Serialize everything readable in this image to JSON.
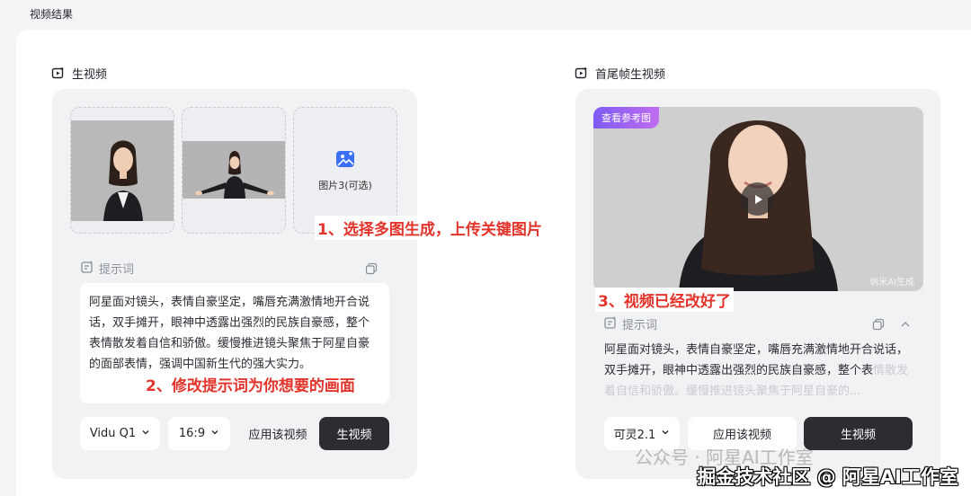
{
  "page": {
    "title": "视频结果"
  },
  "left_panel": {
    "header": "生视频",
    "image_slot_3_label": "图片3(可选)",
    "annotation_upload": "1、选择多图生成，上传关键图片",
    "prompt_label": "提示词",
    "prompt_text": "阿星面对镜头，表情自豪坚定，嘴唇充满激情地开合说话，双手摊开，眼神中透露出强烈的民族自豪感，整个表情散发着自信和骄傲。缓慢推进镜头聚焦于阿星自豪的面部表情，强调中国新生代的强大实力。",
    "annotation_prompt": "2、修改提示词为你想要的画面",
    "model_select": "Vidu Q1",
    "ratio_select": "16:9",
    "apply_button": "应用该视频",
    "generate_button": "生视频"
  },
  "right_panel": {
    "header": "首尾帧生视频",
    "ref_tag": "查看参考图",
    "video_watermark": "纳米AI生成",
    "annotation_done": "3、视频已经改好了",
    "prompt_label": "提示词",
    "prompt_text": "阿星面对镜头，表情自豪坚定，嘴唇充满激情地开合说话，双手摊开，眼神中透露出强烈的民族自豪感，整个表",
    "prompt_text_faded": "情散发着自信和骄傲。缓慢推进镜头聚焦于阿星自豪的...",
    "model_select": "可灵2.1",
    "apply_button": "应用该视频",
    "generate_button": "生视频"
  },
  "overlay": {
    "wechat_watermark": "公众号 · 阿星AI工作室",
    "credit": "掘金技术社区 @ 阿星AI工作室"
  },
  "colors": {
    "annotation_red": "#e2342b",
    "dark_button": "#2b2d33",
    "tag_gradient_start": "#7d5cf2",
    "tag_gradient_end": "#c06cf0"
  }
}
